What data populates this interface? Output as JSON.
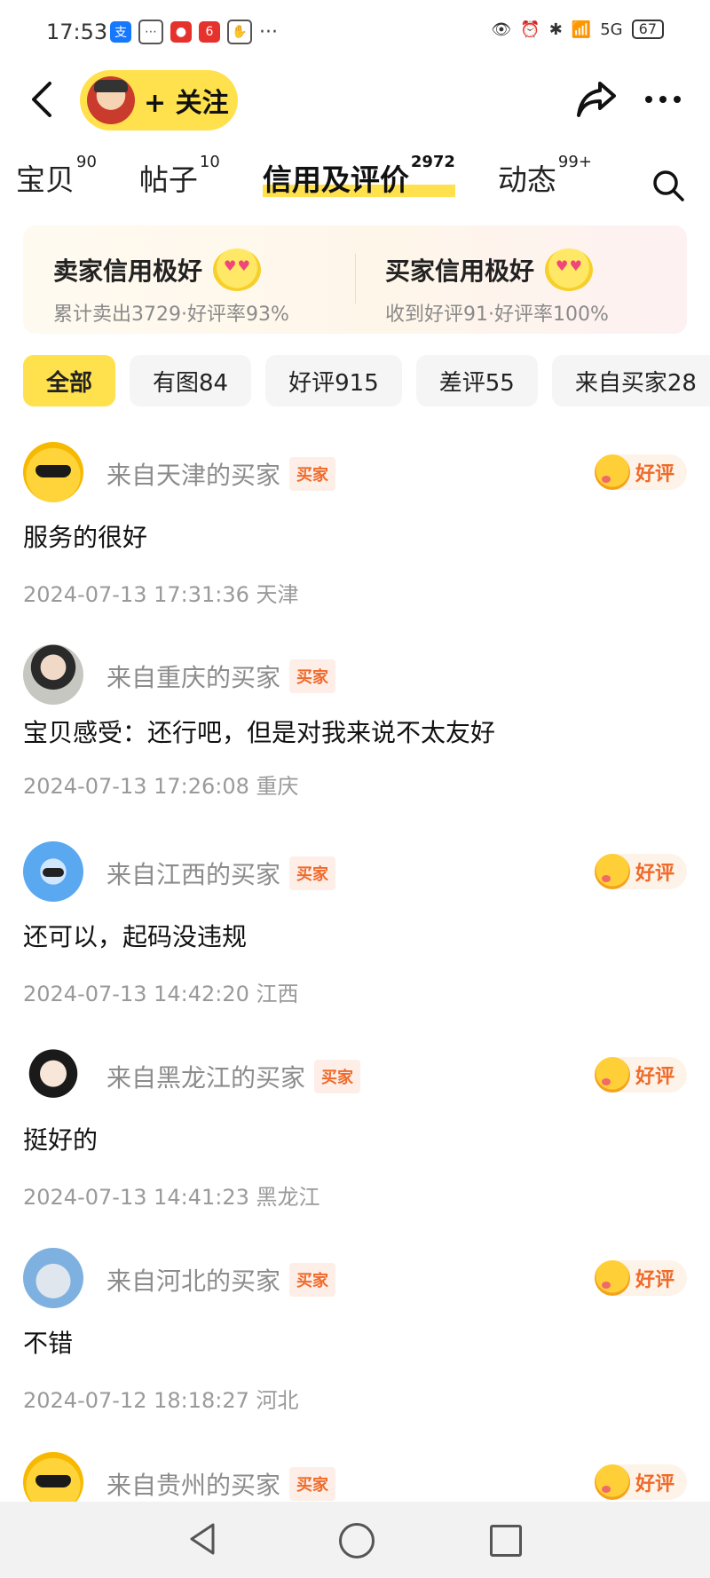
{
  "status_bar": {
    "time": "17:53",
    "icons": [
      "alipay-icon",
      "chat-icon",
      "app-red-icon",
      "app-618-icon",
      "hand-icon",
      "more-dots"
    ],
    "network": "5G",
    "battery": "67"
  },
  "header": {
    "follow_label": "+ 关注"
  },
  "tabs": [
    {
      "label": "宝贝",
      "count": "90"
    },
    {
      "label": "帖子",
      "count": "10"
    },
    {
      "label": "信用及评价",
      "count": "2972"
    },
    {
      "label": "动态",
      "count": "99+"
    }
  ],
  "credit": {
    "seller_title": "卖家信用极好",
    "seller_sub": "累计卖出3729·好评率93%",
    "buyer_title": "买家信用极好",
    "buyer_sub": "收到好评91·好评率100%"
  },
  "filters": [
    "全部",
    "有图84",
    "好评915",
    "差评55",
    "来自买家28"
  ],
  "reviews": [
    {
      "from": "来自天津的买家",
      "tag": "买家",
      "rating": "好评",
      "text": "服务的很好",
      "datetime": "2024-07-13 17:31:36",
      "location": "天津"
    },
    {
      "from": "来自重庆的买家",
      "tag": "买家",
      "rating": "",
      "text": "宝贝感受：还行吧，但是对我来说不太友好",
      "datetime": "2024-07-13 17:26:08",
      "location": "重庆"
    },
    {
      "from": "来自江西的买家",
      "tag": "买家",
      "rating": "好评",
      "text": "还可以，起码没违规",
      "datetime": "2024-07-13 14:42:20",
      "location": "江西"
    },
    {
      "from": "来自黑龙江的买家",
      "tag": "买家",
      "rating": "好评",
      "text": "挺好的",
      "datetime": "2024-07-13 14:41:23",
      "location": "黑龙江"
    },
    {
      "from": "来自河北的买家",
      "tag": "买家",
      "rating": "好评",
      "text": "不错",
      "datetime": "2024-07-12 18:18:27",
      "location": "河北"
    },
    {
      "from": "来自贵州的买家",
      "tag": "买家",
      "rating": "好评",
      "text": "",
      "datetime": "",
      "location": ""
    }
  ],
  "colors": {
    "accent": "#ffe14d",
    "tag": "#f06a2a"
  }
}
